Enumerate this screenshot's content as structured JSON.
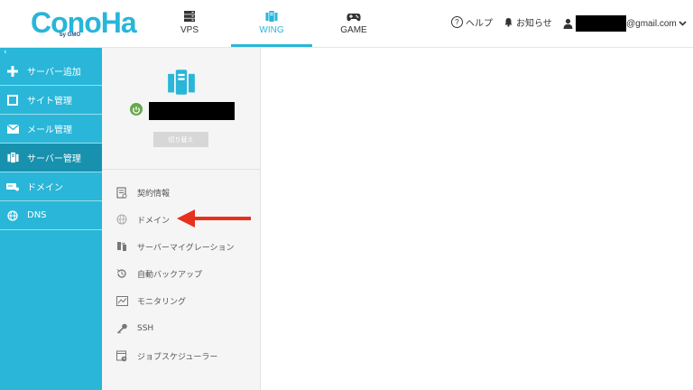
{
  "logo": {
    "text": "ConoHa",
    "sub": "by GMO"
  },
  "top_tabs": [
    {
      "label": "VPS",
      "icon": "server-stack-icon"
    },
    {
      "label": "WING",
      "icon": "wing-server-icon",
      "active": true
    },
    {
      "label": "GAME",
      "icon": "gamepad-icon"
    }
  ],
  "header_right": {
    "help": "ヘルプ",
    "notifications": "お知らせ",
    "account_suffix": "@gmail.com"
  },
  "sidebar": {
    "collapse_glyph": "‹",
    "items": [
      {
        "label": "サーバー追加",
        "icon": "plus-icon"
      },
      {
        "label": "サイト管理",
        "icon": "window-icon"
      },
      {
        "label": "メール管理",
        "icon": "mail-icon"
      },
      {
        "label": "サーバー管理",
        "icon": "server-icon",
        "active": true
      },
      {
        "label": "ドメイン",
        "icon": "domain-icon"
      },
      {
        "label": "DNS",
        "icon": "globe-icon"
      }
    ]
  },
  "server_panel": {
    "switch_label": "切り替え",
    "status_color": "#68a84c"
  },
  "server_menu": [
    {
      "label": "契約情報",
      "icon": "contract-icon"
    },
    {
      "label": "ドメイン",
      "icon": "www-icon"
    },
    {
      "label": "サーバーマイグレーション",
      "icon": "migration-icon"
    },
    {
      "label": "自動バックアップ",
      "icon": "backup-icon"
    },
    {
      "label": "モニタリング",
      "icon": "monitor-icon"
    },
    {
      "label": "SSH",
      "icon": "key-icon"
    },
    {
      "label": "ジョブスケジューラー",
      "icon": "scheduler-icon"
    }
  ],
  "colors": {
    "accent": "#29b6d8",
    "sidebar_active": "#1791ae",
    "arrow": "#e8301f"
  }
}
